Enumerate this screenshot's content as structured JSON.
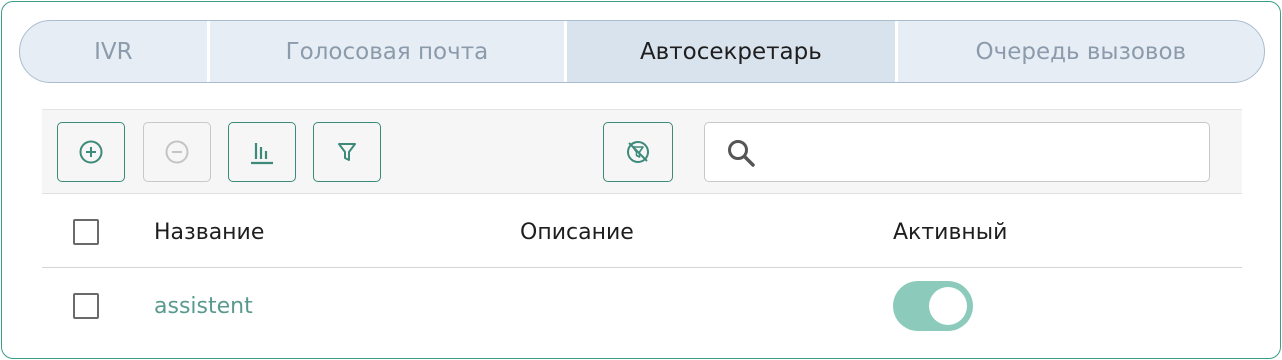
{
  "tabs": [
    {
      "label": "IVR",
      "active": false
    },
    {
      "label": "Голосовая почта",
      "active": false
    },
    {
      "label": "Автосекретарь",
      "active": true
    },
    {
      "label": "Очередь вызовов",
      "active": false
    }
  ],
  "toolbar": {
    "add_icon": "plus-circle-icon",
    "remove_icon": "minus-circle-icon",
    "remove_disabled": true,
    "columns_icon": "columns-icon",
    "filter_icon": "filter-icon",
    "reset_icon": "no-filter-icon",
    "search_icon": "search-icon",
    "search_value": "",
    "search_placeholder": ""
  },
  "table": {
    "headers": {
      "name": "Название",
      "description": "Описание",
      "active": "Активный"
    },
    "rows": [
      {
        "name": "assistent",
        "description": "",
        "active": true
      }
    ]
  },
  "colors": {
    "accent": "#3d8a7a",
    "link": "#5a9a8e",
    "toggle_on": "#8ccbbb",
    "tab_bg": "#e6edf5",
    "tab_active_bg": "#d9e3ee"
  }
}
